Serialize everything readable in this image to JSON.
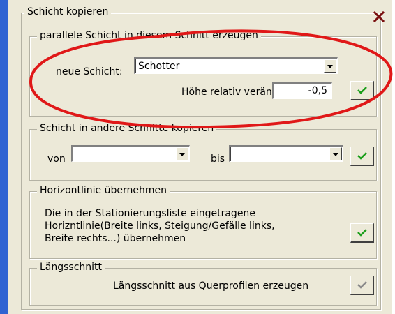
{
  "dialog": {
    "title": "Schicht kopieren",
    "close_label": "✕"
  },
  "group_parallel": {
    "legend": "parallele Schicht in diesem Schnitt erzeugen",
    "neue_schicht_label": "neue Schicht:",
    "neue_schicht_value": "Schotter",
    "hoehe_label": "Höhe relativ verändern",
    "hoehe_value": "-0,5"
  },
  "group_copy": {
    "legend": "Schicht in andere Schnitte kopieren",
    "von_label": "von",
    "von_value": "",
    "bis_label": "bis",
    "bis_value": ""
  },
  "group_horizont": {
    "legend": "Horizontlinie übernehmen",
    "description_line1": "Die in der Stationierungsliste eingetragene",
    "description_line2": "Horizntlinie(Breite links, Steigung/Gefälle links,",
    "description_line3": "Breite rechts...) übernehmen"
  },
  "group_laengs": {
    "legend": "Längsschnitt",
    "description": "Längsschnitt aus Querprofilen erzeugen"
  },
  "colors": {
    "annotation_ellipse": "#e01818",
    "check_enabled": "#1a9e1a",
    "check_disabled": "#8a8a8a"
  }
}
